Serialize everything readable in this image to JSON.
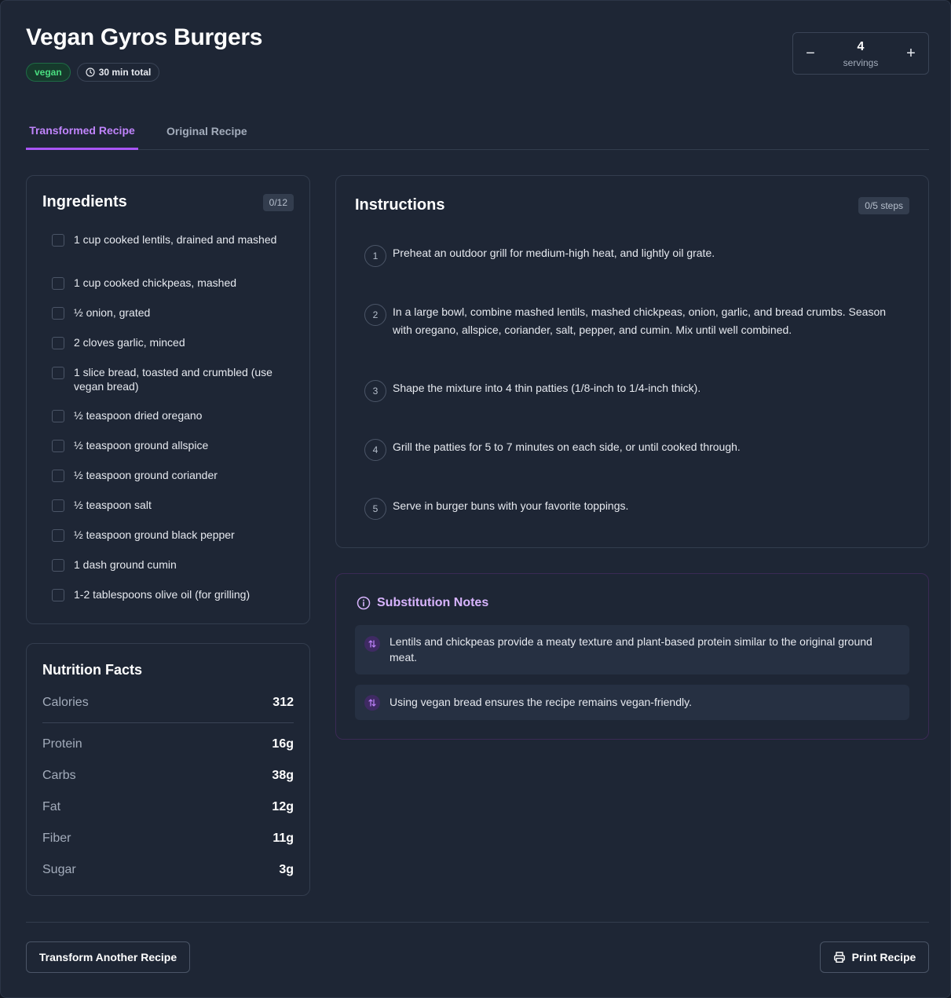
{
  "recipe": {
    "title": "Vegan Gyros Burgers",
    "diet_badge": "vegan",
    "time_badge": "30 min total"
  },
  "servings": {
    "count": "4",
    "label": "servings",
    "decrease_symbol": "−",
    "increase_symbol": "+"
  },
  "tabs": [
    {
      "label": "Transformed Recipe",
      "active": true
    },
    {
      "label": "Original Recipe",
      "active": false
    }
  ],
  "ingredients": {
    "title": "Ingredients",
    "progress": "0/12",
    "items": [
      "1 cup cooked lentils, drained and mashed",
      "1 cup cooked chickpeas, mashed",
      "½ onion, grated",
      "2 cloves garlic, minced",
      "1 slice bread, toasted and crumbled (use vegan bread)",
      "½ teaspoon dried oregano",
      "½ teaspoon ground allspice",
      "½ teaspoon ground coriander",
      "½ teaspoon salt",
      "½ teaspoon ground black pepper",
      "1 dash ground cumin",
      "1-2 tablespoons olive oil (for grilling)"
    ]
  },
  "nutrition": {
    "title": "Nutrition Facts",
    "calories": {
      "label": "Calories",
      "value": "312"
    },
    "rows": [
      {
        "label": "Protein",
        "value": "16g"
      },
      {
        "label": "Carbs",
        "value": "38g"
      },
      {
        "label": "Fat",
        "value": "12g"
      },
      {
        "label": "Fiber",
        "value": "11g"
      },
      {
        "label": "Sugar",
        "value": "3g"
      }
    ]
  },
  "instructions": {
    "title": "Instructions",
    "progress": "0/5 steps",
    "steps": [
      {
        "num": "1",
        "text": "Preheat an outdoor grill for medium-high heat, and lightly oil grate."
      },
      {
        "num": "2",
        "text": "In a large bowl, combine mashed lentils, mashed chickpeas, onion, garlic, and bread crumbs. Season with oregano, allspice, coriander, salt, pepper, and cumin. Mix until well combined."
      },
      {
        "num": "3",
        "text": "Shape the mixture into 4 thin patties (1/8-inch to 1/4-inch thick)."
      },
      {
        "num": "4",
        "text": "Grill the patties for 5 to 7 minutes on each side, or until cooked through."
      },
      {
        "num": "5",
        "text": "Serve in burger buns with your favorite toppings."
      }
    ]
  },
  "substitution_notes": {
    "title": "Substitution Notes",
    "items": [
      "Lentils and chickpeas provide a meaty texture and plant-based protein similar to the original ground meat.",
      "Using vegan bread ensures the recipe remains vegan-friendly."
    ]
  },
  "footer": {
    "transform_label": "Transform Another Recipe",
    "print_label": "Print Recipe"
  },
  "colors": {
    "accent": "#a855f7",
    "vegan_badge": "#4ade80",
    "background": "#1e2635"
  },
  "icons": {
    "time": "clock-icon",
    "info": "info-icon",
    "swap": "swap-icon",
    "print": "printer-icon"
  }
}
